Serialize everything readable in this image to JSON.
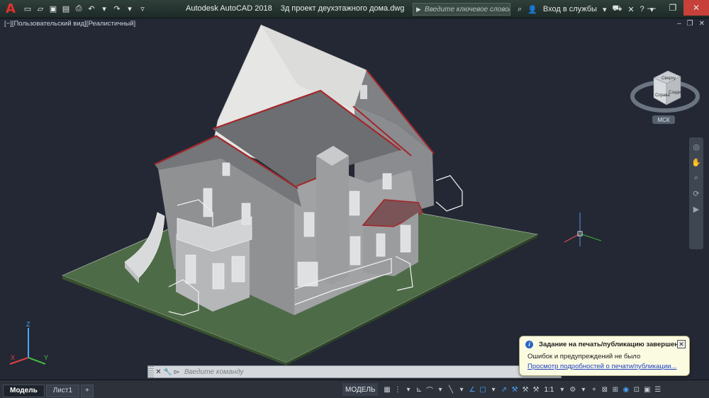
{
  "app": {
    "name": "Autodesk AutoCAD 2018",
    "document": "3д проект деухэтажного дома.dwg",
    "logo": "A"
  },
  "search": {
    "placeholder": "Введите ключевое слово/фразу"
  },
  "account": {
    "signin_label": "Вход в службы"
  },
  "viewport": {
    "label": "[−][Пользовательский вид][Реалистичный]",
    "wcs_label": "МСК",
    "viewcube": {
      "top": "Сверху",
      "front": "Справа",
      "side": "Сзади"
    },
    "background": "#232834",
    "ground_color": "#4e6b48",
    "wall_color": "#8f9193",
    "roof_color": "#7b7d80",
    "roof_edge_color": "#a4262a"
  },
  "command_line": {
    "placeholder": "Введите команду"
  },
  "notification": {
    "title": "Задание на печать/публикацию завершено",
    "message": "Ошибок и предупреждений не было",
    "link": "Просмотр подробностей о печати/публикации..."
  },
  "status_bar": {
    "tabs": [
      {
        "label": "Модель",
        "active": true
      },
      {
        "label": "Лист1",
        "active": false
      },
      {
        "label": "+",
        "active": false
      }
    ],
    "model_label": "МОДЕЛЬ",
    "scale": "1:1"
  }
}
